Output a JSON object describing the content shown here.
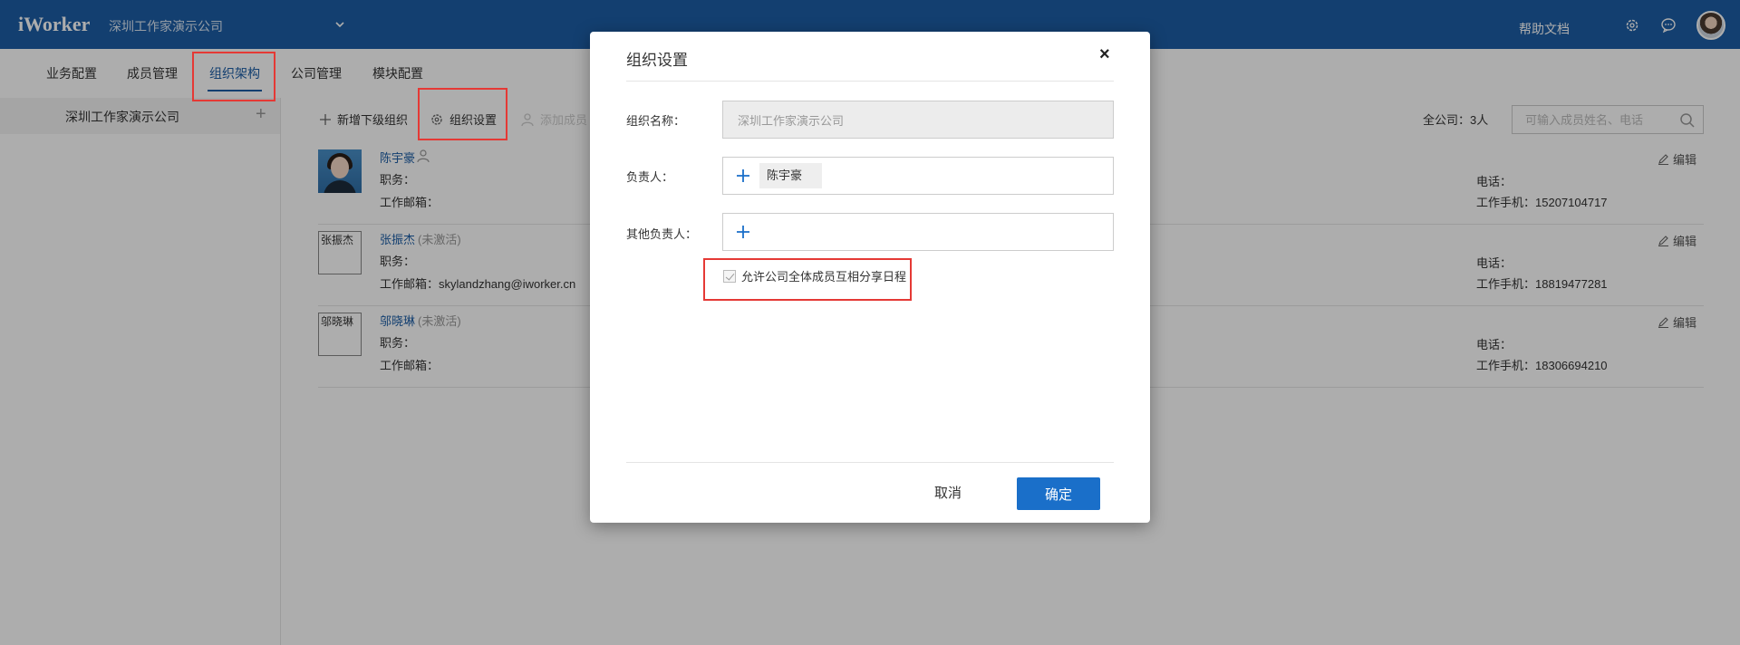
{
  "app": {
    "logo": "iWorker",
    "company": "深圳工作家演示公司",
    "help": "帮助文档"
  },
  "tabs": [
    {
      "label": "业务配置"
    },
    {
      "label": "成员管理"
    },
    {
      "label": "组织架构",
      "active": true
    },
    {
      "label": "公司管理"
    },
    {
      "label": "模块配置"
    }
  ],
  "sidebar": {
    "items": [
      {
        "label": "深圳工作家演示公司"
      }
    ]
  },
  "toolbar": {
    "add_sub_org": "新增下级组织",
    "org_settings": "组织设置",
    "add_member": "添加成员",
    "count": "全公司：3人",
    "search_placeholder": "可输入成员姓名、电话"
  },
  "members": [
    {
      "name": "陈宇豪",
      "status": "",
      "position": "职务：",
      "email": "工作邮箱：",
      "phone": "电话：",
      "mobile": "工作手机：15207104717",
      "edit": "编辑",
      "avatar_alt": ""
    },
    {
      "name": "张振杰",
      "status": "(未激活)",
      "position": "职务：",
      "email": "工作邮箱：skylandzhang@iworker.cn",
      "phone": "电话：",
      "mobile": "工作手机：18819477281",
      "edit": "编辑",
      "avatar_alt": "张振杰"
    },
    {
      "name": "邬晓琳",
      "status": "(未激活)",
      "position": "职务：",
      "email": "工作邮箱：",
      "phone": "电话：",
      "mobile": "工作手机：18306694210",
      "edit": "编辑",
      "avatar_alt": "邬晓琳"
    }
  ],
  "modal": {
    "title": "组织设置",
    "close": "×",
    "org_name_label": "组织名称：",
    "org_name_value": "深圳工作家演示公司",
    "leader_label": "负责人：",
    "leader_tag": "陈宇豪",
    "other_leaders_label": "其他负责人：",
    "share_checkbox_label": "允许公司全体成员互相分享日程",
    "share_checked": true,
    "cancel": "取消",
    "ok": "确定"
  },
  "colors": {
    "primary": "#1c5ea6",
    "button": "#1a6fc9",
    "highlight": "#e53935"
  }
}
